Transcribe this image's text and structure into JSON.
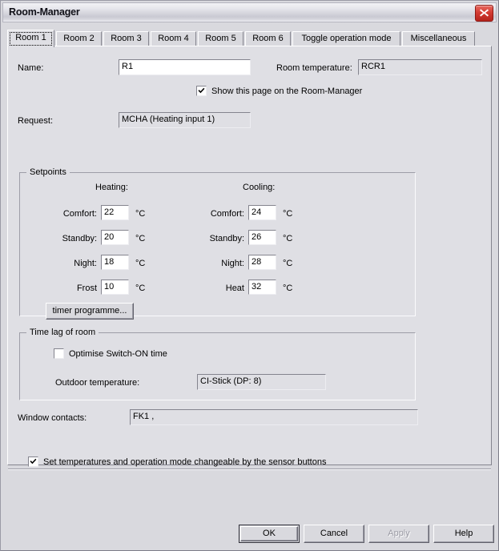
{
  "window": {
    "title": "Room-Manager",
    "close_icon": "close-icon"
  },
  "tabs": [
    {
      "label": "Room 1",
      "selected": true
    },
    {
      "label": "Room 2",
      "selected": false
    },
    {
      "label": "Room 3",
      "selected": false
    },
    {
      "label": "Room 4",
      "selected": false
    },
    {
      "label": "Room 5",
      "selected": false
    },
    {
      "label": "Room 6",
      "selected": false
    },
    {
      "label": "Toggle operation mode",
      "selected": false
    },
    {
      "label": "Miscellaneous",
      "selected": false
    }
  ],
  "page": {
    "name": {
      "label": "Name:",
      "value": "R1"
    },
    "room_temperature": {
      "label": "Room temperature:",
      "value": "RCR1"
    },
    "show_page": {
      "label": "Show this page on the Room-Manager",
      "checked": true
    },
    "request": {
      "label": "Request:",
      "value": "MCHA  (Heating input 1)"
    },
    "setpoints": {
      "title": "Setpoints",
      "heating_header": "Heating:",
      "cooling_header": "Cooling:",
      "unit": "°C",
      "heating": [
        {
          "label": "Comfort:",
          "value": "22"
        },
        {
          "label": "Standby:",
          "value": "20"
        },
        {
          "label": "Night:",
          "value": "18"
        },
        {
          "label": "Frost",
          "value": "10"
        }
      ],
      "cooling": [
        {
          "label": "Comfort:",
          "value": "24"
        },
        {
          "label": "Standby:",
          "value": "26"
        },
        {
          "label": "Night:",
          "value": "28"
        },
        {
          "label": "Heat",
          "value": "32"
        }
      ],
      "timer_button": "timer programme..."
    },
    "time_lag": {
      "title": "Time lag of room",
      "optimise": {
        "label": "Optimise Switch-ON time",
        "checked": false
      },
      "outdoor": {
        "label": "Outdoor temperature:",
        "value": "CI-Stick  (DP: 8)"
      }
    },
    "window_contacts": {
      "label": "Window contacts:",
      "value": "FK1 ,"
    },
    "sensor_buttons": {
      "label": "Set temperatures and operation mode changeable by the sensor buttons",
      "checked": true
    }
  },
  "footer": {
    "ok": "OK",
    "cancel": "Cancel",
    "apply": "Apply",
    "help": "Help"
  }
}
